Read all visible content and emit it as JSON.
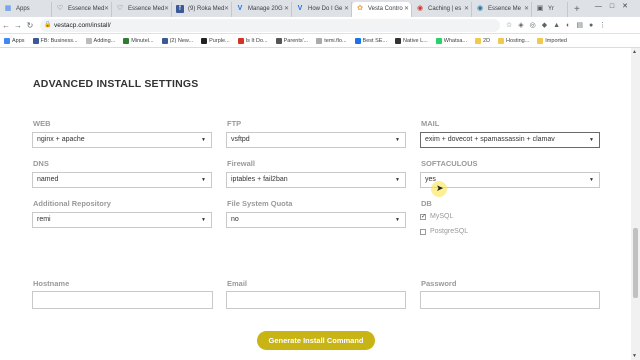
{
  "browser": {
    "tabs": [
      {
        "label": "Apps",
        "icon": "apps-icon"
      },
      {
        "label": "Essence Med",
        "icon": "heart-icon"
      },
      {
        "label": "Essence Med",
        "icon": "heart-icon"
      },
      {
        "label": "(9) Roka Med",
        "icon": "facebook-icon"
      },
      {
        "label": "Manage 20G",
        "icon": "v-icon"
      },
      {
        "label": "How Do I Ge",
        "icon": "v-icon"
      },
      {
        "label": "Vesta Contro",
        "icon": "vesta-icon",
        "active": true
      },
      {
        "label": "Caching | es",
        "icon": "wp-icon"
      },
      {
        "label": "Essence Me",
        "icon": "wp-icon"
      },
      {
        "label": "Yr",
        "icon": "tab-icon"
      }
    ],
    "url": "vestacp.com/install/",
    "bookmarks": [
      "Apps",
      "FB: Business...",
      "Adding...",
      "Minutel...",
      "(2) New...",
      "Purple...",
      "Is It Do...",
      "Parents'...",
      "temi.flo...",
      "Best SE...",
      "Native L...",
      "Whatsa...",
      "2D",
      "Hosting...",
      "Imported"
    ]
  },
  "page": {
    "section_title": "ADVANCED INSTALL SETTINGS",
    "web": {
      "label": "WEB",
      "value": "nginx + apache"
    },
    "ftp": {
      "label": "FTP",
      "value": "vsftpd"
    },
    "mail": {
      "label": "MAIL",
      "value": "exim + dovecot + spamassassin + clamav"
    },
    "dns": {
      "label": "DNS",
      "value": "named"
    },
    "firewall": {
      "label": "Firewall",
      "value": "iptables + fail2ban"
    },
    "softaculous": {
      "label": "SOFTACULOUS",
      "value": "yes"
    },
    "repo": {
      "label": "Additional Repository",
      "value": "remi"
    },
    "quota": {
      "label": "File System Quota",
      "value": "no"
    },
    "db": {
      "label": "DB",
      "options": [
        {
          "label": "MySQL",
          "checked": true
        },
        {
          "label": "PostgreSQL",
          "checked": false
        }
      ]
    },
    "hostname": {
      "label": "Hostname",
      "value": ""
    },
    "email": {
      "label": "Email",
      "value": ""
    },
    "password": {
      "label": "Password",
      "value": ""
    },
    "generate_button": "Generate Install Command"
  },
  "colors": {
    "button": "#c8b414",
    "label": "#999999",
    "heading": "#333333"
  }
}
